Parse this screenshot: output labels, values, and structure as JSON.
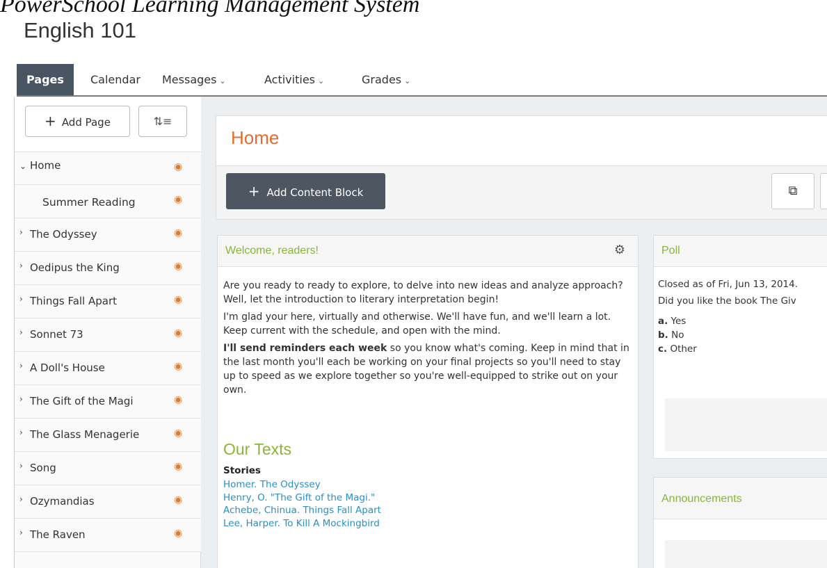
{
  "caption": "PowerSchool Learning Management System",
  "course": {
    "title": "English 101"
  },
  "nav": {
    "items": [
      {
        "label": "Pages"
      },
      {
        "label": "Calendar"
      },
      {
        "label": "Messages"
      },
      {
        "label": "Activities"
      },
      {
        "label": "Grades"
      }
    ],
    "caret_glyph": "⌄"
  },
  "sidebar": {
    "add_page_label": "Add Page",
    "plus_glyph": "+",
    "reorder_glyph": "⇅≡",
    "rss_glyph": "◉",
    "expanded_glyph": "⌄",
    "collapsed_glyph": "›",
    "pages": [
      {
        "label": "Home"
      },
      {
        "label": "Summer Reading"
      },
      {
        "label": "The Odyssey"
      },
      {
        "label": "Oedipus the King"
      },
      {
        "label": "Things Fall Apart"
      },
      {
        "label": "Sonnet 73"
      },
      {
        "label": "A Doll's House"
      },
      {
        "label": "The Gift of the Magi"
      },
      {
        "label": "The Glass Menagerie"
      },
      {
        "label": "Song"
      },
      {
        "label": "Ozymandias"
      },
      {
        "label": "The Raven"
      }
    ]
  },
  "main": {
    "page_title": "Home",
    "add_block_label": "Add Content Block",
    "copy_glyph": "⧉",
    "gear_glyph": "⚙"
  },
  "welcome": {
    "title": "Welcome, readers!",
    "p1": "Are you ready to ready to explore, to delve into new ideas and analyze approach? Well, let the introduction to literary interpretation begin!",
    "p2": "I'm glad your here, virtually and otherwise. We'll have fun, and we'll learn a lot. Keep current with the schedule, and open with the mind.",
    "p3_bold": "I'll send reminders each week",
    "p3_rest": " so you know what's coming. Keep in mind that in the last month you'll each be working on your final projects so you'll need to stay up to speed as we explore together so you're well-equipped to strike out on your own.",
    "texts_heading": "Our Texts",
    "stories_label": "Stories",
    "stories": [
      "Homer. The Odyssey",
      "Henry, O. \"The Gift of the Magi.\"",
      "Achebe, Chinua. Things Fall Apart",
      "Lee, Harper. To Kill A Mockingbird"
    ]
  },
  "poll": {
    "title": "Poll",
    "closed_text": "Closed as of Fri, Jun 13, 2014.",
    "question": "Did you like the book The Giv",
    "options": [
      {
        "letter": "a.",
        "text": "Yes"
      },
      {
        "letter": "b.",
        "text": "No"
      },
      {
        "letter": "c.",
        "text": "Other"
      }
    ]
  },
  "announcements": {
    "title": "Announcements"
  },
  "colors": {
    "accent_orange": "#e46c2c",
    "accent_green": "#8ab43a",
    "nav_active": "#4a5563",
    "link_blue": "#2a8fc5"
  }
}
